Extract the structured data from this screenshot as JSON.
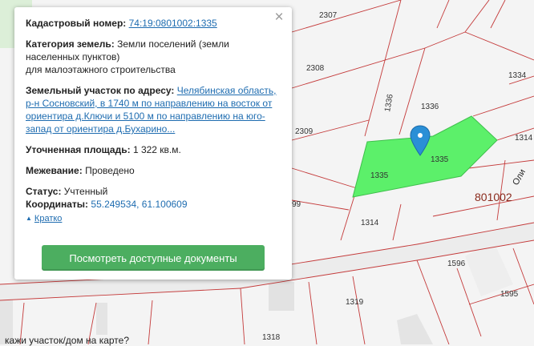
{
  "popup": {
    "cadastral_label": "Кадастровый номер:",
    "cadastral_number": "74:19:0801002:1335",
    "category_label": "Категория земель:",
    "category_value_line1": "Земли поселений (земли",
    "category_value_line2": "населенных пунктов)",
    "category_value_line3": "для малоэтажного строительства",
    "address_label": "Земельный участок по адресу:",
    "address_line1": "Челябинская область,",
    "address_line2": "р-н Сосновский, в 1740 м по направлению на восток от",
    "address_line3": "ориентира д.Ключи и 5100 м по направлению на юго-",
    "address_line4": "запад от ориентира д.Бухарино...",
    "area_label": "Уточненная площадь:",
    "area_value": "1 322 кв.м.",
    "survey_label": "Межевание:",
    "survey_value": "Проведено",
    "status_label": "Статус:",
    "status_value": "Учтенный",
    "coords_label": "Координаты:",
    "coords_value": "55.249534, 61.100609",
    "collapse_link": "Кратко",
    "docs_button": "Посмотреть доступные документы",
    "close_icon": "close-x-icon"
  },
  "map": {
    "plot_labels": {
      "p2307": "2307",
      "p2308": "2308",
      "p2309": "2309",
      "p1336a": "1336",
      "p1336b": "1336",
      "p1335a": "1335",
      "p1335b": "1335",
      "p1314a": "1314",
      "p1314b": "1314",
      "p1334": "1334",
      "p1596": "1596",
      "p1595": "1595",
      "p1319": "1319",
      "p1318": "1318",
      "p99": "99"
    },
    "quarter_label": "801002",
    "street_label": "Оли",
    "selected_parcel_color": "#5cf06a",
    "marker_icon": "map-pin-icon",
    "marker_color": "#2a8fd6"
  },
  "bottom_text": "кажи участок/дом на карте?"
}
